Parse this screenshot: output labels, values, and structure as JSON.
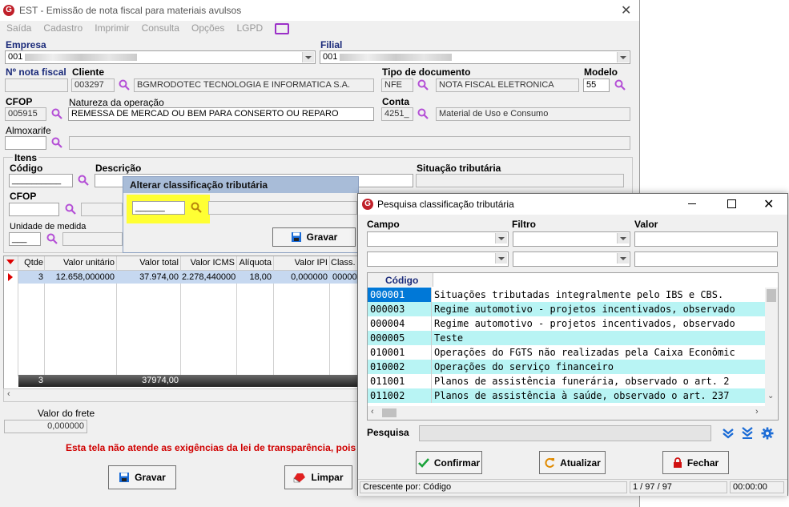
{
  "main": {
    "title": "EST - Emissão de nota fiscal para materiais avulsos",
    "menu": [
      "Saída",
      "Cadastro",
      "Imprimir",
      "Consulta",
      "Opções",
      "LGPD"
    ],
    "empresa_label": "Empresa",
    "empresa_value": "001",
    "filial_label": "Filial",
    "filial_value": "001",
    "nota_label": "Nº nota fiscal",
    "cliente_label": "Cliente",
    "cliente_code": "003297",
    "cliente_name": "BGMRODOTEC TECNOLOGIA E INFORMATICA S.A.",
    "tipo_doc_label": "Tipo de documento",
    "tipo_doc_code": "NFE",
    "tipo_doc_name": "NOTA FISCAL ELETRONICA",
    "modelo_label": "Modelo",
    "modelo_value": "55",
    "cfop_label": "CFOP",
    "cfop_value": "005915",
    "natureza_label": "Natureza da operação",
    "natureza_value": "REMESSA DE MERCAD OU BEM PARA CONSERTO OU REPARO",
    "conta_label": "Conta",
    "conta_code": "4251_",
    "conta_name": "Material de Uso e Consumo",
    "almox_label": "Almoxarife",
    "itens_label": "Itens",
    "codigo_label": "Código",
    "descricao_label": "Descrição",
    "situacao_label": "Situação tributária",
    "item_cfop_label": "CFOP",
    "unidade_label": "Unidade de medida",
    "grid_headers": [
      "Qtde",
      "Valor unitário",
      "Valor total",
      "Valor ICMS",
      "Alíquota",
      "Valor IPI",
      "Class."
    ],
    "grid_row": [
      "3",
      "12.658,000000",
      "37.974,00",
      "2.278,440000",
      "18,00",
      "0,000000",
      "00000"
    ],
    "grid_total_qtde": "3",
    "grid_total_valor": "37974,00",
    "frete_label": "Valor do frete",
    "frete_value": "0,000000",
    "warning": "Esta tela não atende as exigências da lei de transparência, pois",
    "gravar_button": "Gravar",
    "limpar_button": "Limpar"
  },
  "alterar": {
    "title": "Alterar classificação tributária",
    "code_value": "______",
    "gravar_button": "Gravar"
  },
  "pesquisa": {
    "title": "Pesquisa classificação tributária",
    "campo_label": "Campo",
    "filtro_label": "Filtro",
    "valor_label": "Valor",
    "codigo_header": "Código",
    "rows": [
      {
        "code": "000001",
        "desc": "Situações tributadas integralmente pelo IBS e CBS."
      },
      {
        "code": "000003",
        "desc": "Regime automotivo - projetos incentivados, observado"
      },
      {
        "code": "000004",
        "desc": "Regime automotivo - projetos incentivados, observado"
      },
      {
        "code": "000005",
        "desc": "Teste"
      },
      {
        "code": "010001",
        "desc": "Operações do FGTS não realizadas pela Caixa Econômic"
      },
      {
        "code": "010002",
        "desc": "Operações do serviço financeiro"
      },
      {
        "code": "011001",
        "desc": "Planos de assistência funerária, observado o art. 2"
      },
      {
        "code": "011002",
        "desc": "Planos de assistência à saúde, observado o art. 237"
      }
    ],
    "pesquisa_label": "Pesquisa",
    "confirmar_button": "Confirmar",
    "atualizar_button": "Atualizar",
    "fechar_button": "Fechar",
    "status_order": "Crescente por: Código",
    "status_count": "1 / 97 / 97",
    "status_time": "00:00:00"
  },
  "colors": {
    "selected_row": "#0078d7",
    "alt_row": "#b8f4f4",
    "highlight": "#ffff33",
    "brand": "#c0202a",
    "icon_blue": "#1a6bd6"
  }
}
